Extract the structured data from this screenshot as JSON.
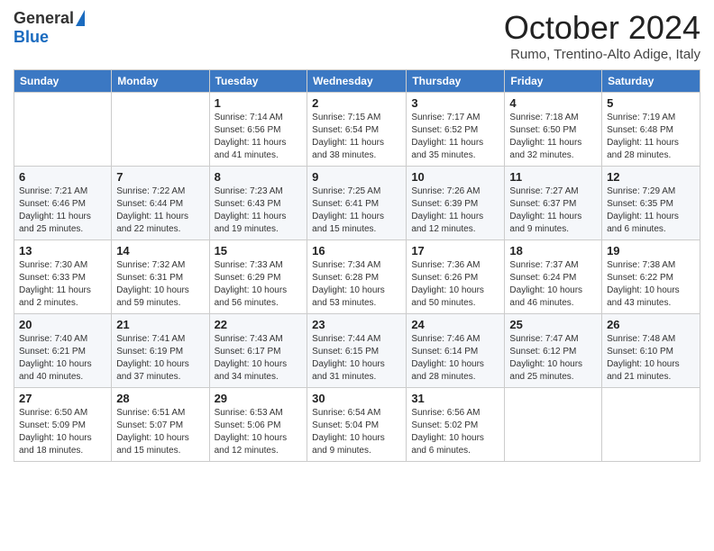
{
  "logo": {
    "general": "General",
    "blue": "Blue"
  },
  "header": {
    "month": "October 2024",
    "location": "Rumo, Trentino-Alto Adige, Italy"
  },
  "days_of_week": [
    "Sunday",
    "Monday",
    "Tuesday",
    "Wednesday",
    "Thursday",
    "Friday",
    "Saturday"
  ],
  "weeks": [
    [
      {
        "day": "",
        "sunrise": "",
        "sunset": "",
        "daylight": ""
      },
      {
        "day": "",
        "sunrise": "",
        "sunset": "",
        "daylight": ""
      },
      {
        "day": "1",
        "sunrise": "Sunrise: 7:14 AM",
        "sunset": "Sunset: 6:56 PM",
        "daylight": "Daylight: 11 hours and 41 minutes."
      },
      {
        "day": "2",
        "sunrise": "Sunrise: 7:15 AM",
        "sunset": "Sunset: 6:54 PM",
        "daylight": "Daylight: 11 hours and 38 minutes."
      },
      {
        "day": "3",
        "sunrise": "Sunrise: 7:17 AM",
        "sunset": "Sunset: 6:52 PM",
        "daylight": "Daylight: 11 hours and 35 minutes."
      },
      {
        "day": "4",
        "sunrise": "Sunrise: 7:18 AM",
        "sunset": "Sunset: 6:50 PM",
        "daylight": "Daylight: 11 hours and 32 minutes."
      },
      {
        "day": "5",
        "sunrise": "Sunrise: 7:19 AM",
        "sunset": "Sunset: 6:48 PM",
        "daylight": "Daylight: 11 hours and 28 minutes."
      }
    ],
    [
      {
        "day": "6",
        "sunrise": "Sunrise: 7:21 AM",
        "sunset": "Sunset: 6:46 PM",
        "daylight": "Daylight: 11 hours and 25 minutes."
      },
      {
        "day": "7",
        "sunrise": "Sunrise: 7:22 AM",
        "sunset": "Sunset: 6:44 PM",
        "daylight": "Daylight: 11 hours and 22 minutes."
      },
      {
        "day": "8",
        "sunrise": "Sunrise: 7:23 AM",
        "sunset": "Sunset: 6:43 PM",
        "daylight": "Daylight: 11 hours and 19 minutes."
      },
      {
        "day": "9",
        "sunrise": "Sunrise: 7:25 AM",
        "sunset": "Sunset: 6:41 PM",
        "daylight": "Daylight: 11 hours and 15 minutes."
      },
      {
        "day": "10",
        "sunrise": "Sunrise: 7:26 AM",
        "sunset": "Sunset: 6:39 PM",
        "daylight": "Daylight: 11 hours and 12 minutes."
      },
      {
        "day": "11",
        "sunrise": "Sunrise: 7:27 AM",
        "sunset": "Sunset: 6:37 PM",
        "daylight": "Daylight: 11 hours and 9 minutes."
      },
      {
        "day": "12",
        "sunrise": "Sunrise: 7:29 AM",
        "sunset": "Sunset: 6:35 PM",
        "daylight": "Daylight: 11 hours and 6 minutes."
      }
    ],
    [
      {
        "day": "13",
        "sunrise": "Sunrise: 7:30 AM",
        "sunset": "Sunset: 6:33 PM",
        "daylight": "Daylight: 11 hours and 2 minutes."
      },
      {
        "day": "14",
        "sunrise": "Sunrise: 7:32 AM",
        "sunset": "Sunset: 6:31 PM",
        "daylight": "Daylight: 10 hours and 59 minutes."
      },
      {
        "day": "15",
        "sunrise": "Sunrise: 7:33 AM",
        "sunset": "Sunset: 6:29 PM",
        "daylight": "Daylight: 10 hours and 56 minutes."
      },
      {
        "day": "16",
        "sunrise": "Sunrise: 7:34 AM",
        "sunset": "Sunset: 6:28 PM",
        "daylight": "Daylight: 10 hours and 53 minutes."
      },
      {
        "day": "17",
        "sunrise": "Sunrise: 7:36 AM",
        "sunset": "Sunset: 6:26 PM",
        "daylight": "Daylight: 10 hours and 50 minutes."
      },
      {
        "day": "18",
        "sunrise": "Sunrise: 7:37 AM",
        "sunset": "Sunset: 6:24 PM",
        "daylight": "Daylight: 10 hours and 46 minutes."
      },
      {
        "day": "19",
        "sunrise": "Sunrise: 7:38 AM",
        "sunset": "Sunset: 6:22 PM",
        "daylight": "Daylight: 10 hours and 43 minutes."
      }
    ],
    [
      {
        "day": "20",
        "sunrise": "Sunrise: 7:40 AM",
        "sunset": "Sunset: 6:21 PM",
        "daylight": "Daylight: 10 hours and 40 minutes."
      },
      {
        "day": "21",
        "sunrise": "Sunrise: 7:41 AM",
        "sunset": "Sunset: 6:19 PM",
        "daylight": "Daylight: 10 hours and 37 minutes."
      },
      {
        "day": "22",
        "sunrise": "Sunrise: 7:43 AM",
        "sunset": "Sunset: 6:17 PM",
        "daylight": "Daylight: 10 hours and 34 minutes."
      },
      {
        "day": "23",
        "sunrise": "Sunrise: 7:44 AM",
        "sunset": "Sunset: 6:15 PM",
        "daylight": "Daylight: 10 hours and 31 minutes."
      },
      {
        "day": "24",
        "sunrise": "Sunrise: 7:46 AM",
        "sunset": "Sunset: 6:14 PM",
        "daylight": "Daylight: 10 hours and 28 minutes."
      },
      {
        "day": "25",
        "sunrise": "Sunrise: 7:47 AM",
        "sunset": "Sunset: 6:12 PM",
        "daylight": "Daylight: 10 hours and 25 minutes."
      },
      {
        "day": "26",
        "sunrise": "Sunrise: 7:48 AM",
        "sunset": "Sunset: 6:10 PM",
        "daylight": "Daylight: 10 hours and 21 minutes."
      }
    ],
    [
      {
        "day": "27",
        "sunrise": "Sunrise: 6:50 AM",
        "sunset": "Sunset: 5:09 PM",
        "daylight": "Daylight: 10 hours and 18 minutes."
      },
      {
        "day": "28",
        "sunrise": "Sunrise: 6:51 AM",
        "sunset": "Sunset: 5:07 PM",
        "daylight": "Daylight: 10 hours and 15 minutes."
      },
      {
        "day": "29",
        "sunrise": "Sunrise: 6:53 AM",
        "sunset": "Sunset: 5:06 PM",
        "daylight": "Daylight: 10 hours and 12 minutes."
      },
      {
        "day": "30",
        "sunrise": "Sunrise: 6:54 AM",
        "sunset": "Sunset: 5:04 PM",
        "daylight": "Daylight: 10 hours and 9 minutes."
      },
      {
        "day": "31",
        "sunrise": "Sunrise: 6:56 AM",
        "sunset": "Sunset: 5:02 PM",
        "daylight": "Daylight: 10 hours and 6 minutes."
      },
      {
        "day": "",
        "sunrise": "",
        "sunset": "",
        "daylight": ""
      },
      {
        "day": "",
        "sunrise": "",
        "sunset": "",
        "daylight": ""
      }
    ]
  ]
}
